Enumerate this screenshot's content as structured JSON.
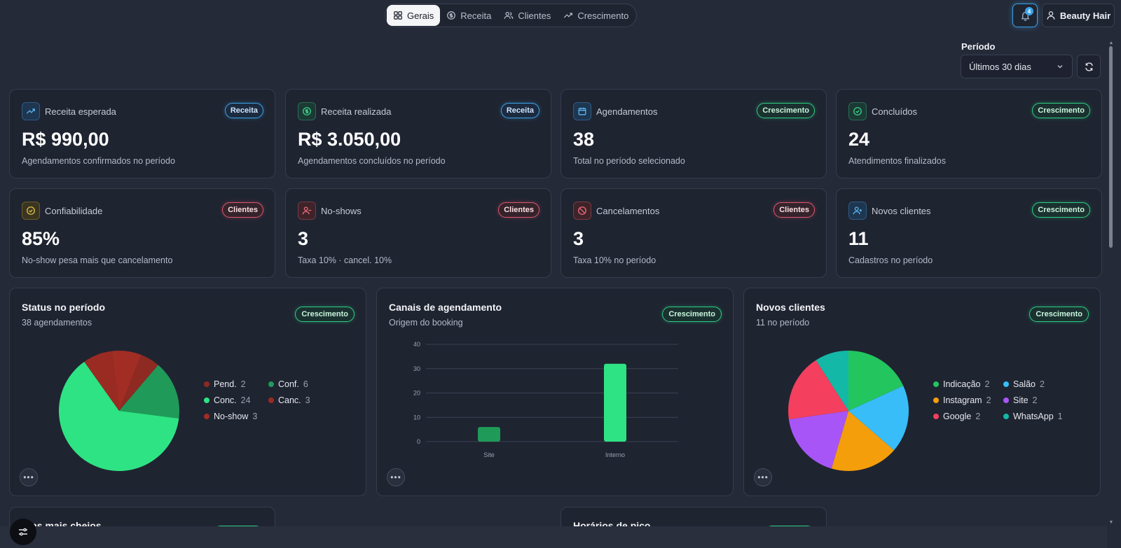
{
  "nav": {
    "tabs": [
      {
        "label": "Gerais",
        "icon": "grid-icon",
        "active": true
      },
      {
        "label": "Receita",
        "icon": "dollar-circle-icon",
        "active": false
      },
      {
        "label": "Clientes",
        "icon": "users-icon",
        "active": false
      },
      {
        "label": "Crescimento",
        "icon": "trending-up-icon",
        "active": false
      }
    ]
  },
  "header": {
    "notification_count": "4",
    "user_label": "Beauty Hair"
  },
  "filter": {
    "label": "Período",
    "selected": "Últimos 30 dias"
  },
  "metrics": [
    {
      "title": "Receita esperada",
      "badge": "Receita",
      "value": "R$ 990,00",
      "sub": "Agendamentos confirmados no período",
      "icon": "trending-up-icon"
    },
    {
      "title": "Receita realizada",
      "badge": "Receita",
      "value": "R$ 3.050,00",
      "sub": "Agendamentos concluídos no período",
      "icon": "dollar-circle-icon"
    },
    {
      "title": "Agendamentos",
      "badge": "Crescimento",
      "value": "38",
      "sub": "Total no período selecionado",
      "icon": "calendar-icon"
    },
    {
      "title": "Concluídos",
      "badge": "Crescimento",
      "value": "24",
      "sub": "Atendimentos finalizados",
      "icon": "check-circle-icon"
    },
    {
      "title": "Confiabilidade",
      "badge": "Clientes",
      "value": "85%",
      "sub": "No-show pesa mais que cancelamento",
      "icon": "check-circle-icon"
    },
    {
      "title": "No-shows",
      "badge": "Clientes",
      "value": "3",
      "sub": "Taxa 10% · cancel. 10%",
      "icon": "user-minus-icon"
    },
    {
      "title": "Cancelamentos",
      "badge": "Clientes",
      "value": "3",
      "sub": "Taxa 10% no período",
      "icon": "ban-icon"
    },
    {
      "title": "Novos clientes",
      "badge": "Crescimento",
      "value": "11",
      "sub": "Cadastros no período",
      "icon": "user-plus-icon"
    }
  ],
  "panels": {
    "status": {
      "title": "Status no período",
      "sub": "38 agendamentos",
      "badge": "Crescimento"
    },
    "canais": {
      "title": "Canais de agendamento",
      "sub": "Origem do booking",
      "badge": "Crescimento"
    },
    "novos": {
      "title": "Novos clientes",
      "sub": "11 no período",
      "badge": "Crescimento"
    }
  },
  "bottom_cards": [
    {
      "title": "Dias mais cheios"
    },
    {
      "title": "Horários de pico"
    }
  ],
  "colors": {
    "receita": "#3aa3e8",
    "crescimento": "#2ccf83",
    "clientes": "#e0566d"
  },
  "chart_data": [
    {
      "type": "pie",
      "categories": [
        "Pend.",
        "Conf.",
        "Conc.",
        "Canc.",
        "No-show"
      ],
      "values": [
        2,
        6,
        24,
        3,
        3
      ],
      "colors": [
        "#8e2a22",
        "#1f9a58",
        "#2ee383",
        "#9a2b23",
        "#a12d24"
      ],
      "legend_position": "right"
    },
    {
      "type": "bar",
      "categories": [
        "Site",
        "Interno"
      ],
      "values": [
        6,
        32
      ],
      "colors": [
        "#1f9a58",
        "#2ee383"
      ],
      "ylim": [
        0,
        40
      ],
      "yticks": [
        0,
        10,
        20,
        30,
        40
      ],
      "grid": true
    },
    {
      "type": "pie",
      "categories": [
        "Indicação",
        "Salão",
        "Instagram",
        "Site",
        "Google",
        "WhatsApp"
      ],
      "values": [
        2,
        2,
        2,
        2,
        2,
        1
      ],
      "colors": [
        "#22c55e",
        "#38bdf8",
        "#f59e0b",
        "#a855f7",
        "#f43f5e",
        "#14b8a6"
      ],
      "legend_position": "right"
    }
  ]
}
